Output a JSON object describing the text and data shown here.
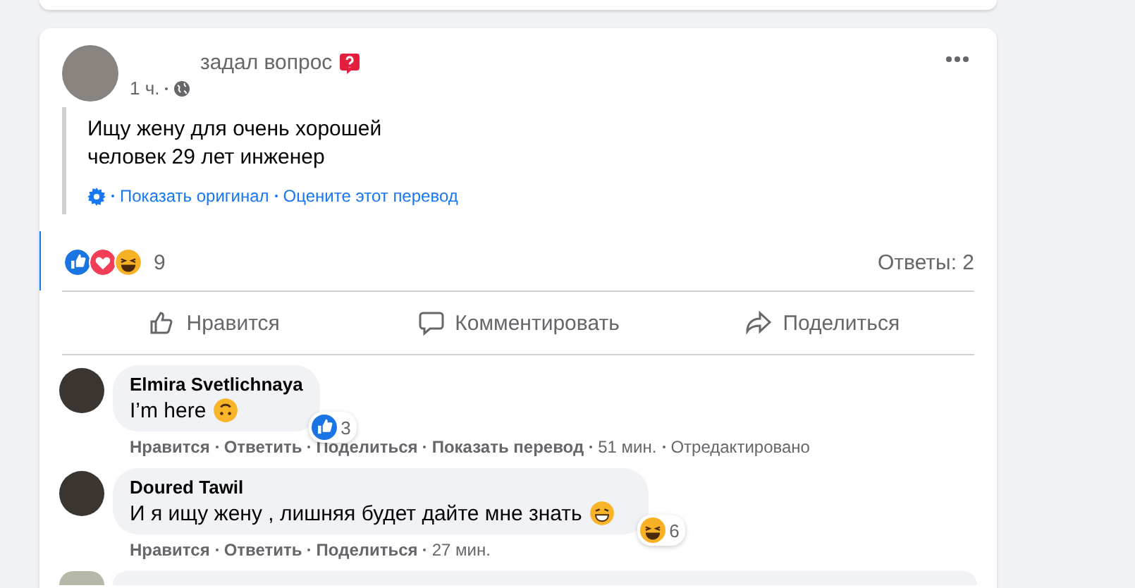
{
  "post": {
    "header_text": "задал вопрос",
    "time": "1 ч.",
    "body_lines": [
      "Ищу жену для очень хорошей",
      "человек 29 лет инженер"
    ],
    "translation_links": [
      {
        "text": "Показать оригинал"
      },
      {
        "text": "Оцените этот перевод"
      }
    ],
    "reactions": {
      "icons": [
        {
          "kind": "like"
        },
        {
          "kind": "love"
        },
        {
          "kind": "haha"
        }
      ],
      "count": "9"
    },
    "answers": "Ответы: 2",
    "actions": [
      {
        "kind": "like",
        "label": "Нравится"
      },
      {
        "kind": "comment",
        "label": "Комментировать"
      },
      {
        "kind": "share",
        "label": "Поделиться"
      }
    ]
  },
  "comments": [
    {
      "author": "Elmira Svetlichnaya",
      "text": "I’m here",
      "emoji": {
        "kind": "upside"
      },
      "reactions": {
        "icons": [
          {
            "kind": "like"
          }
        ],
        "count": "3"
      },
      "actions": [
        {
          "kind": "link",
          "text": "Нравится"
        },
        {
          "kind": "link",
          "text": "Ответить"
        },
        {
          "kind": "link",
          "text": "Поделиться"
        },
        {
          "kind": "link",
          "text": "Показать перевод"
        },
        {
          "kind": "meta",
          "text": "51 мин."
        },
        {
          "kind": "meta",
          "text": "Отредактировано"
        }
      ]
    },
    {
      "author": "Doured Tawil",
      "text": "И я ищу жену , лишняя будет дайте мне знать",
      "emoji": {
        "kind": "grin"
      },
      "reactions": {
        "icons": [
          {
            "kind": "haha"
          }
        ],
        "count": "6"
      },
      "actions": [
        {
          "kind": "link",
          "text": "Нравится"
        },
        {
          "kind": "link",
          "text": "Ответить"
        },
        {
          "kind": "link",
          "text": "Поделиться"
        },
        {
          "kind": "meta",
          "text": "27 мин."
        }
      ]
    }
  ]
}
